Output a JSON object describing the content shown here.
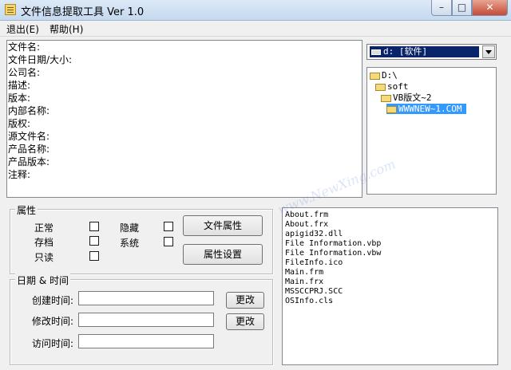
{
  "window": {
    "title": "文件信息提取工具 Ver 1.0",
    "minimize_glyph": "–",
    "maximize_glyph": "□",
    "close_glyph": "✕"
  },
  "menu": {
    "exit_label": "退出(E)",
    "help_label": "帮助(H)"
  },
  "info": {
    "lines": [
      "文件名:",
      "文件日期/大小:",
      "公司名:",
      "描述:",
      "版本:",
      "内部名称:",
      "版权:",
      "源文件名:",
      "产品名称:",
      "产品版本:",
      "注释:"
    ]
  },
  "drive": {
    "selected": "d: [软件]"
  },
  "tree": {
    "items": [
      "D:\\",
      "soft",
      "VB版文~2",
      "WWWNEW~1.COM"
    ]
  },
  "attributes": {
    "group_title": "属性",
    "normal_label": "正常",
    "hidden_label": "隐藏",
    "archive_label": "存档",
    "system_label": "系统",
    "readonly_label": "只读",
    "file_attr_button": "文件属性",
    "attr_settings_button": "属性设置"
  },
  "datetime": {
    "group_title": "日期 & 时间",
    "created_label": "创建时间:",
    "modified_label": "修改时间:",
    "accessed_label": "访问时间:",
    "created_value": "",
    "modified_value": "",
    "accessed_value": "",
    "change_button": "更改"
  },
  "files": {
    "items": [
      "About.frm",
      "About.frx",
      "apigid32.dll",
      "File Information.vbp",
      "File Information.vbw",
      "FileInfo.ico",
      "Main.frm",
      "Main.frx",
      "MSSCCPRJ.SCC",
      "OSInfo.cls"
    ]
  },
  "watermark": "www.NewXing.com"
}
